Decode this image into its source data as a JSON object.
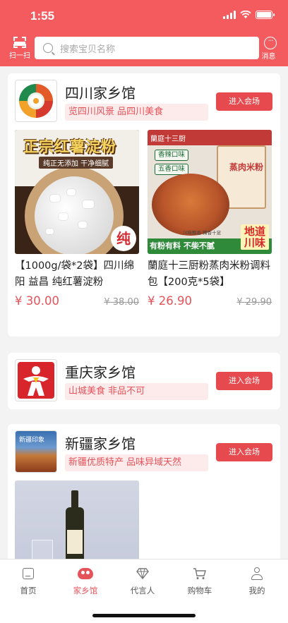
{
  "status_bar": {
    "time": "1:55"
  },
  "header": {
    "scan_label": "扫一扫",
    "search_placeholder": "搜索宝贝名称",
    "message_label": "消息",
    "accent": "#f45b5e"
  },
  "halls": [
    {
      "name": "四川家乡馆",
      "tagline": "览四川风景   品四川美食",
      "enter_label": "进入会场",
      "products": [
        {
          "title": "【1000g/袋*2袋】四川绵阳 益昌 纯红薯淀粉",
          "price": "¥ 30.00",
          "original_price": "¥ 38.00",
          "image_text": {
            "headline": "正宗红薯淀粉",
            "subline": "纯正无添加 干净细腻",
            "badge": "纯"
          }
        },
        {
          "title": "蘭庭十三厨粉蒸肉米粉调料包【200克*5袋】",
          "price": "¥ 26.90",
          "original_price": "¥ 29.90",
          "image_text": {
            "brand": "蘭庭十三厨",
            "flavor1": "香辣口味",
            "flavor2": "五香口味",
            "bag": "蒸肉米粉",
            "slogan": "有粉有料 不柴不腻",
            "corner": "地道川味",
            "mini": "川味飘香  精香十足"
          }
        }
      ]
    },
    {
      "name": "重庆家乡馆",
      "tagline": "山城美食   非品不可",
      "enter_label": "进入会场"
    },
    {
      "name": "新疆家乡馆",
      "tagline": "新疆优质特产   品味异域天然",
      "enter_label": "进入会场",
      "logo_text": "新疆印象"
    }
  ],
  "tabbar": {
    "tabs": [
      {
        "label": "首页",
        "icon": "home-icon",
        "active": false
      },
      {
        "label": "家乡馆",
        "icon": "hometown-icon",
        "active": true
      },
      {
        "label": "代言人",
        "icon": "diamond-icon",
        "active": false
      },
      {
        "label": "购物车",
        "icon": "cart-icon",
        "active": false
      },
      {
        "label": "我的",
        "icon": "profile-icon",
        "active": false
      }
    ],
    "active_color": "#e4535a"
  }
}
